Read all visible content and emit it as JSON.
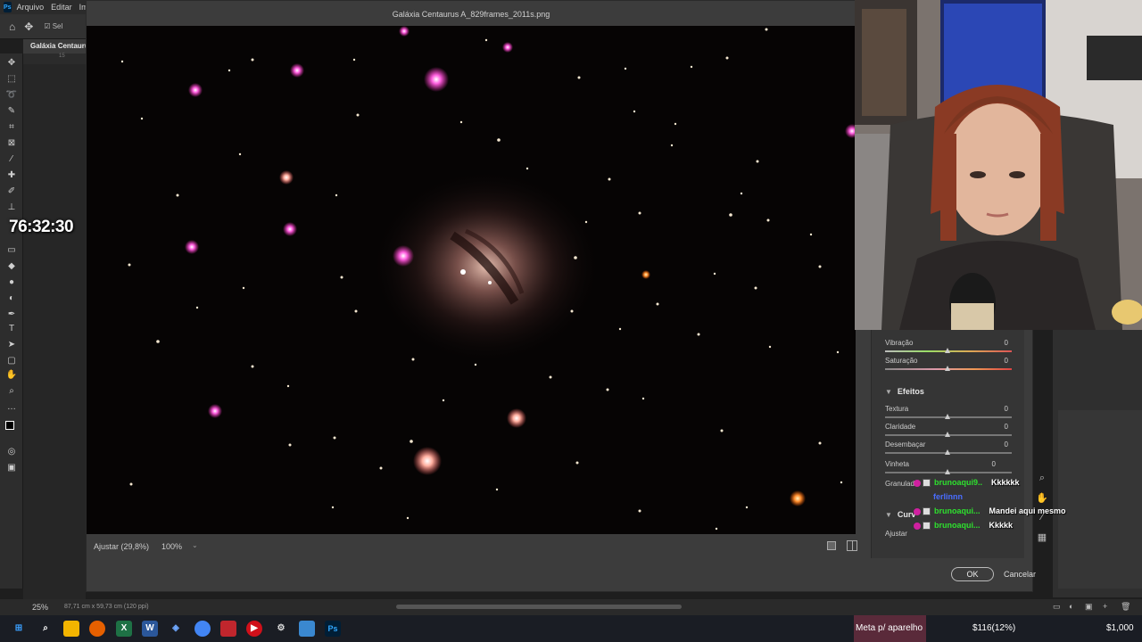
{
  "app": {
    "menu": [
      "Arquivo",
      "Editar",
      "Im"
    ],
    "options_label": "Sel",
    "doc_tab": "Galáxia Centaurus",
    "ruler_mark": "15"
  },
  "stream_timer": "76:32:30",
  "dialog": {
    "title": "Galáxia Centaurus A_829frames_2011s.png",
    "zoom_fit_label": "Ajustar (29,8%)",
    "zoom_value": "100%",
    "ok_label": "OK",
    "cancel_label": "Cancelar"
  },
  "panel": {
    "sliders_top": [
      {
        "label": "Vibração",
        "value": "0"
      },
      {
        "label": "Saturação",
        "value": "0"
      }
    ],
    "effects_title": "Efeitos",
    "effects": [
      {
        "label": "Textura",
        "value": "0"
      },
      {
        "label": "Claridade",
        "value": "0"
      },
      {
        "label": "Desembaçar",
        "value": "0"
      },
      {
        "label": "Vinheta",
        "value": "0"
      }
    ],
    "granulado_label": "Granulado",
    "curves_title": "Curv",
    "ajustar_label": "Ajustar"
  },
  "chat": [
    {
      "user": "brunoaqui9..",
      "message": "Kkkkkk"
    },
    {
      "user": "ferlinnn",
      "message": ""
    },
    {
      "user": "brunoaqui...",
      "message": "Mandei aqui mesmo"
    },
    {
      "user": "brunoaqui...",
      "message": "Kkkkk"
    }
  ],
  "status": {
    "zoom": "25%",
    "doc_info": "87,71 cm x 59,73 cm (120 ppi)"
  },
  "taskbar": {
    "ticker_1": "Meta p/ aparelho",
    "ticker_2": "$116(12%)",
    "ticker_3": "$1,000"
  },
  "colors": {
    "accent_green": "#2ee02e",
    "ps_blue": "#31a8ff"
  }
}
